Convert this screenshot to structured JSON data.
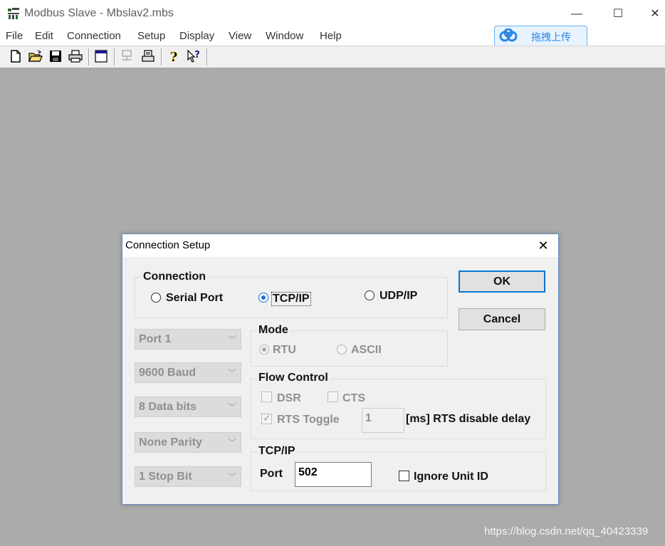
{
  "window": {
    "title": "Modbus Slave - Mbslav2.mbs",
    "app_icon": "modbus-slave-app-icon",
    "controls": {
      "minimize": "—",
      "maximize": "☐",
      "close": "✕"
    }
  },
  "menu": {
    "items": [
      "File",
      "Edit",
      "Connection",
      "Setup",
      "Display",
      "View",
      "Window",
      "Help"
    ]
  },
  "upload_widget": {
    "label": "拖拽上传",
    "icon": "cloud-icon",
    "accent": "#2a86e6"
  },
  "toolbar": {
    "icons": [
      "new-document-icon",
      "open-folder-icon",
      "save-icon",
      "print-icon",
      "window-icon",
      "connect-icon",
      "print-preview-icon",
      "help-icon",
      "context-help-icon"
    ]
  },
  "dialog": {
    "title": "Connection Setup",
    "close_glyph": "✕",
    "connection": {
      "title": "Connection",
      "options": [
        {
          "label": "Serial Port",
          "selected": false
        },
        {
          "label": "TCP/IP",
          "selected": true
        },
        {
          "label": "UDP/IP",
          "selected": false
        }
      ]
    },
    "buttons": {
      "ok": "OK",
      "cancel": "Cancel"
    },
    "serial_settings": {
      "port": "Port 1",
      "baud": "9600 Baud",
      "data_bits": "8 Data bits",
      "parity": "None Parity",
      "stop_bits": "1 Stop Bit"
    },
    "mode": {
      "title": "Mode",
      "options": [
        {
          "label": "RTU",
          "selected": true
        },
        {
          "label": "ASCII",
          "selected": false
        }
      ]
    },
    "flow_control": {
      "title": "Flow Control",
      "dsr": {
        "label": "DSR",
        "checked": false
      },
      "cts": {
        "label": "CTS",
        "checked": false
      },
      "rts_toggle": {
        "label": "RTS Toggle",
        "checked": true
      },
      "rts_delay_value": "1",
      "rts_delay_label": "[ms] RTS disable delay"
    },
    "tcpip": {
      "title": "TCP/IP",
      "port_label": "Port",
      "port_value": "502",
      "ignore_unit_id": {
        "label": "Ignore Unit ID",
        "checked": false
      }
    }
  },
  "watermark": "https://blog.csdn.net/qq_40423339",
  "colors": {
    "workspace": "#ababab",
    "dialog_bg": "#f0f0f0",
    "focus_blue": "#0078d7"
  }
}
